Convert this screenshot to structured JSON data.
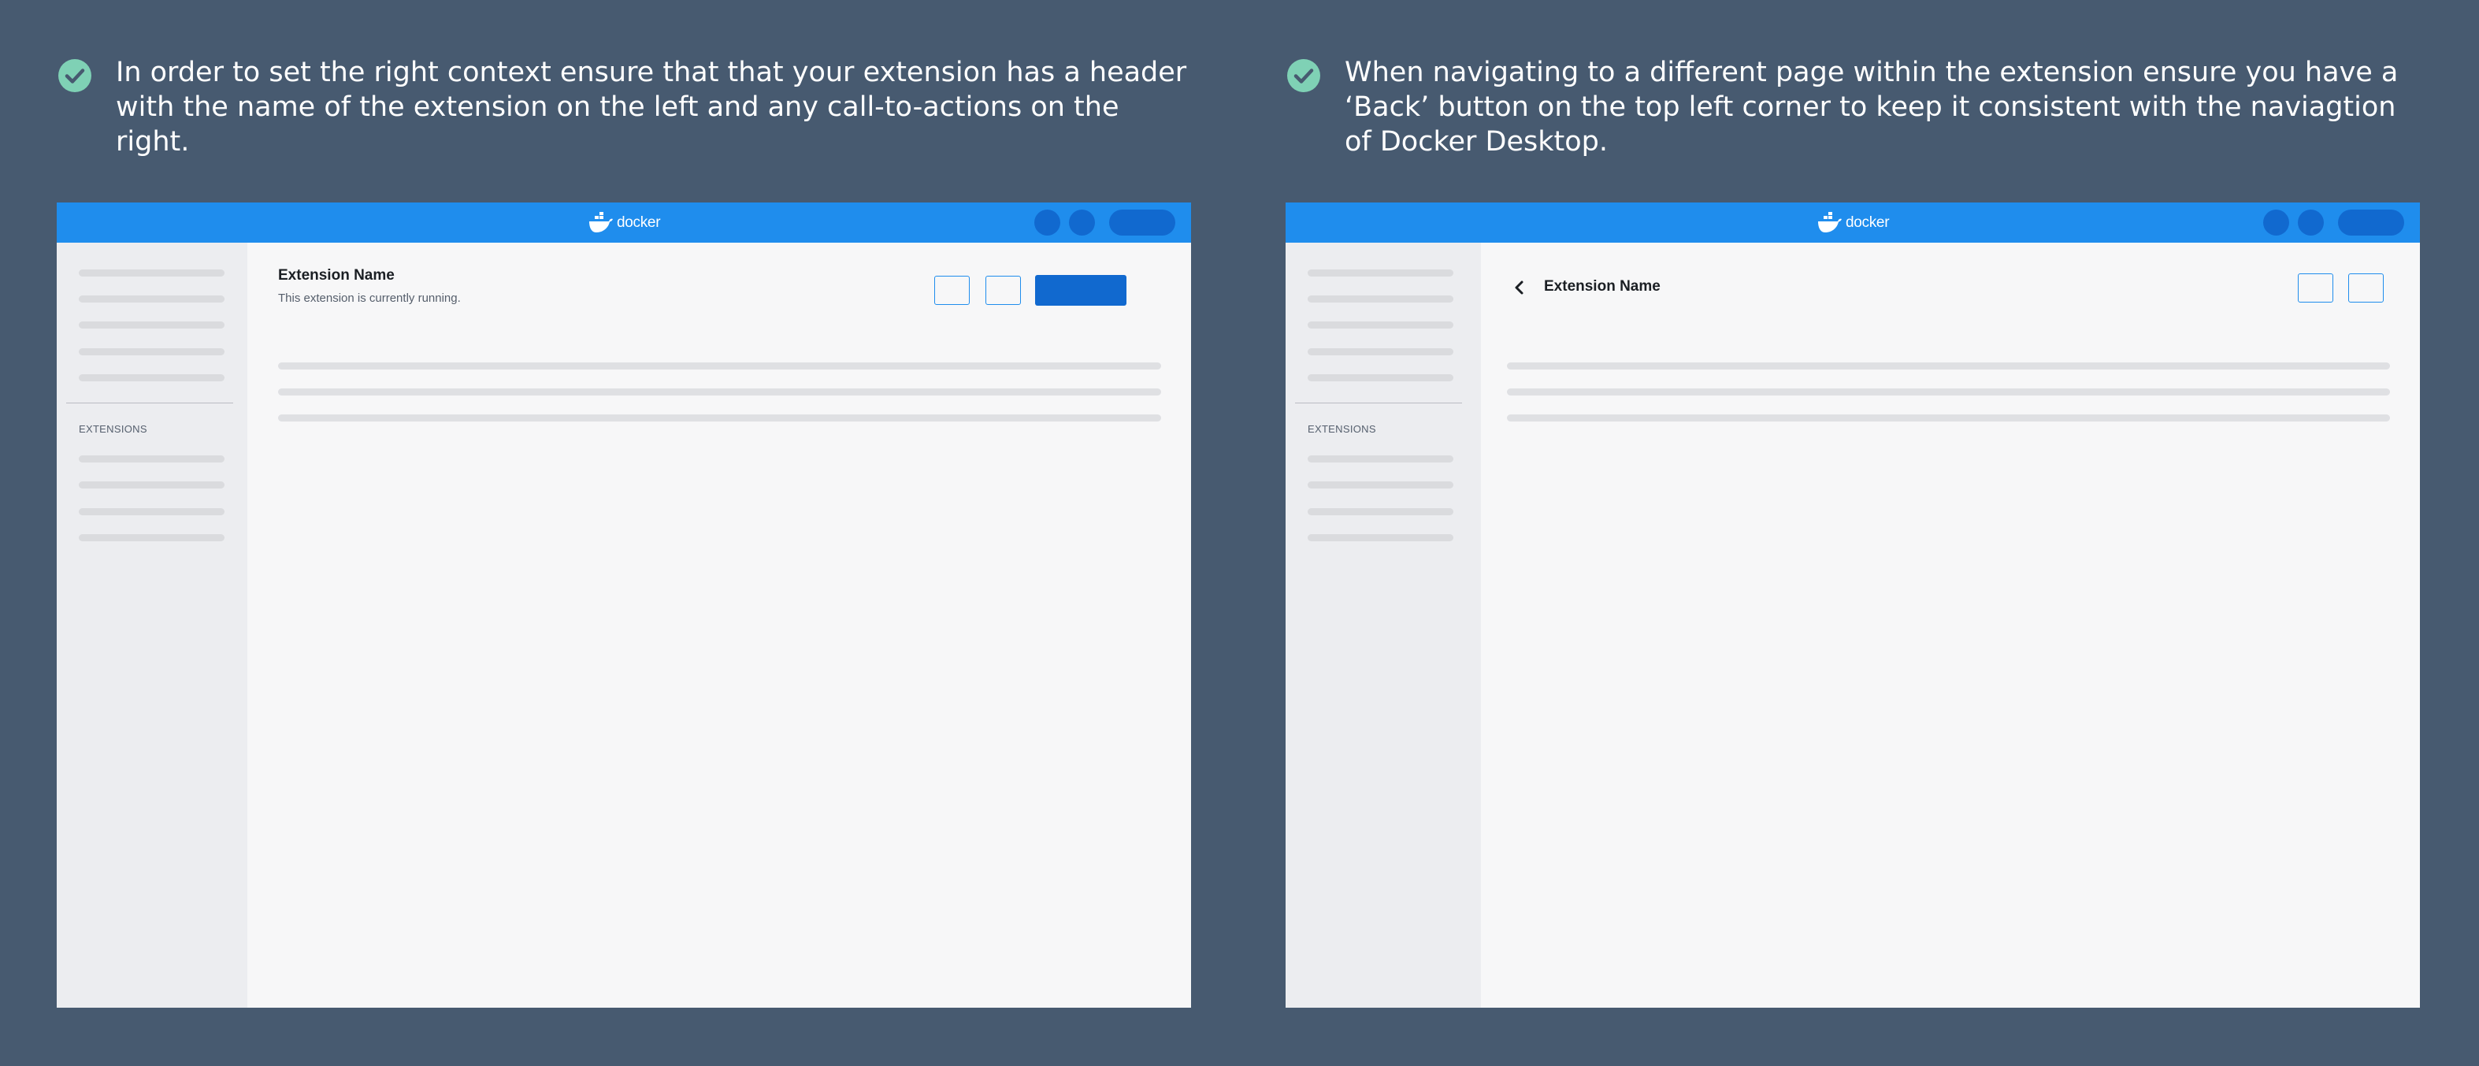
{
  "guidelines": [
    {
      "text": "In order to set the right context ensure that that your extension has a header with the name of the extension on the left and any call-to-actions on the right.",
      "icon": "check-circle-icon",
      "mockup": {
        "brand": "docker",
        "sidebar_section_label": "EXTENSIONS",
        "header_title": "Extension Name",
        "header_subtitle": "This extension is currently running."
      }
    },
    {
      "text": "When navigating to a different page within the extension ensure you have a ‘Back’ button on the top left corner to keep it consistent with the naviagtion of Docker Desktop.",
      "icon": "check-circle-icon",
      "mockup": {
        "brand": "docker",
        "sidebar_section_label": "EXTENSIONS",
        "header_title": "Extension Name",
        "back_icon": "chevron-left-icon"
      }
    }
  ],
  "colors": {
    "background": "#475a70",
    "titlebar": "#1f8ded",
    "accent_dark": "#1169cf",
    "check": "#7fd1b5",
    "sidebar": "#ecedf0",
    "content": "#f7f7f8"
  }
}
